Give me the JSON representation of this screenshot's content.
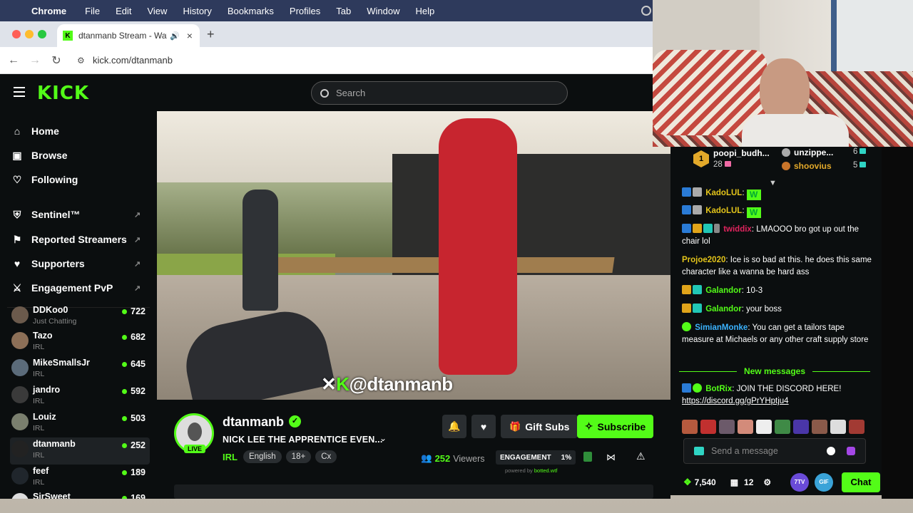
{
  "menubar": {
    "app": "Chrome",
    "items": [
      "File",
      "Edit",
      "View",
      "History",
      "Bookmarks",
      "Profiles",
      "Tab",
      "Window",
      "Help"
    ]
  },
  "browser": {
    "tab_title": "dtanmanb Stream - Watc",
    "url": "kick.com/dtanmanb"
  },
  "kick": {
    "logo": "KICK",
    "search_placeholder": "Search",
    "nav": [
      {
        "label": "Home",
        "icon": "home-icon"
      },
      {
        "label": "Browse",
        "icon": "browse-icon"
      },
      {
        "label": "Following",
        "icon": "heart-icon"
      }
    ],
    "extensions": [
      {
        "label": "Sentinel™",
        "icon": "shield-icon"
      },
      {
        "label": "Reported Streamers",
        "icon": "flag-icon"
      },
      {
        "label": "Supporters",
        "icon": "heart-icon"
      },
      {
        "label": "Engagement PvP",
        "icon": "swords-icon"
      }
    ],
    "channels": [
      {
        "name": "DDKoo0",
        "category": "Just Chatting",
        "viewers": "722"
      },
      {
        "name": "Tazo",
        "category": "IRL",
        "viewers": "682"
      },
      {
        "name": "MikeSmallsJr",
        "category": "IRL",
        "viewers": "645"
      },
      {
        "name": "jandro",
        "category": "IRL",
        "viewers": "592"
      },
      {
        "name": "Louiz",
        "category": "IRL",
        "viewers": "503"
      },
      {
        "name": "dtanmanb",
        "category": "IRL",
        "viewers": "252"
      },
      {
        "name": "feef",
        "category": "IRL",
        "viewers": "189"
      },
      {
        "name": "SirSweet",
        "category": "",
        "viewers": "169"
      }
    ],
    "video_overlay": "@dtanmanb"
  },
  "stream": {
    "streamer": "dtanmanb",
    "live": "LIVE",
    "title": "NICK LEE THE APPRENTICE EVEN...",
    "category": "IRL",
    "tags": [
      "English",
      "18+",
      "Cx"
    ],
    "gift_label": "Gift Subs",
    "subscribe_label": "Subscribe",
    "viewers": "252",
    "viewers_label": "Viewers",
    "engagement_label": "ENGAGEMENT",
    "engagement_value": "1%",
    "powered_prefix": "powered by",
    "powered_brand": "botted.wtf"
  },
  "chat": {
    "gifters": [
      {
        "rank": "1",
        "name": "poopi_budh...",
        "count": "28"
      },
      {
        "name": "unzippe...",
        "count": "6"
      },
      {
        "name": "shoovius",
        "count": "5"
      }
    ],
    "messages": [
      {
        "user": "KadoLUL",
        "user_color": "#53fc18",
        "text": ""
      },
      {
        "user": "KadoLUL",
        "user_color": "#53fc18",
        "text": ""
      },
      {
        "user": "twiddix",
        "user_color": "#e0245e",
        "text": "LMAOOO bro got up out the chair lol"
      },
      {
        "user": "Projoe2020",
        "user_color": "#e3c41a",
        "text": "Ice is so bad at this. he does this same character like a wanna be hard ass"
      },
      {
        "user": "Galandor",
        "user_color": "#53fc18",
        "text": "10-3"
      },
      {
        "user": "Galandor",
        "user_color": "#53fc18",
        "text": "your boss"
      },
      {
        "user": "SimianMonke",
        "user_color": "#3bb3ff",
        "text": "You can get a tailors tape measure at Michaels or any other craft supply store"
      },
      {
        "user": "BotRix",
        "user_color": "#53fc18",
        "text": "JOIN THE DISCORD HERE!",
        "link": "https://discord.gg/gPrYHptju4"
      }
    ],
    "new_messages": "New messages",
    "input_placeholder": "Send a message",
    "points": "7,540",
    "sub_count": "12",
    "btn_7tv": "7TV",
    "btn_gif": "GIF",
    "chat_button": "Chat"
  },
  "colors": {
    "kick_green": "#53fc18",
    "bg": "#0b0e0f"
  }
}
